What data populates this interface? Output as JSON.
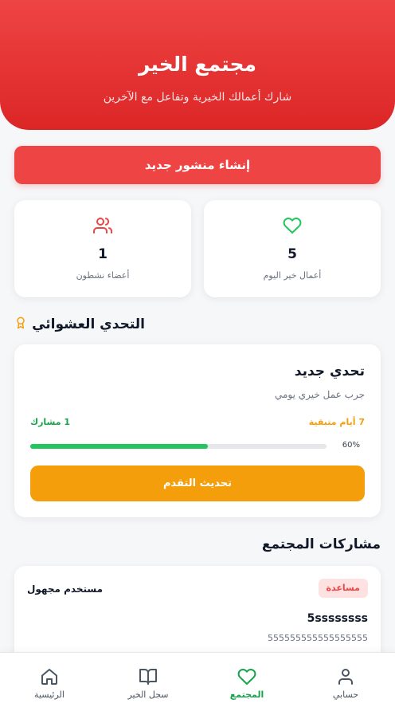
{
  "header": {
    "title": "مجتمع الخير",
    "subtitle": "شارك أعمالك الخيرية وتفاعل مع الآخرين"
  },
  "create_post_label": "إنشاء منشور جديد",
  "stats": [
    {
      "value": "5",
      "label": "أعمال خير اليوم",
      "icon": "heart-icon"
    },
    {
      "value": "1",
      "label": "أعضاء نشطون",
      "icon": "users-icon"
    }
  ],
  "challenge": {
    "section_title": "التحدي العشوائي",
    "title": "تحدي جديد",
    "description": "جرب عمل خيري يومي",
    "days_left": "7 أيام متبقية",
    "participants": "1 مشارك",
    "progress": 60,
    "progress_label": "60%",
    "update_label": "تحديث التقدم"
  },
  "posts": {
    "section_title": "مشاركات المجتمع",
    "items": [
      {
        "badge": "مساعدة",
        "user": "مستخدم مجهول",
        "title": "5ssssssss",
        "body": "555555555555555555"
      }
    ]
  },
  "nav": {
    "items": [
      {
        "label": "حسابي",
        "icon": "user-icon",
        "active": false
      },
      {
        "label": "المجتمع",
        "icon": "heart-icon",
        "active": true
      },
      {
        "label": "سجل الخير",
        "icon": "book-icon",
        "active": false
      },
      {
        "label": "الرئيسية",
        "icon": "home-icon",
        "active": false
      }
    ]
  },
  "colors": {
    "primary": "#ef4444",
    "accent": "#f59e0b",
    "success": "#22c55e"
  }
}
